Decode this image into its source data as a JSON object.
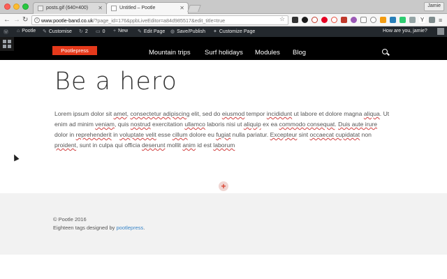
{
  "browser": {
    "tabs": [
      {
        "label": "posts.gif (640×400)"
      },
      {
        "label": "Untitled – Pootle"
      }
    ],
    "profile": "Jamie",
    "url_domain": "www.pootle-band.co.uk",
    "url_path": "/?page_id=176&ppbLiveEditor=a84d985517&edit_title=true"
  },
  "adminbar": {
    "site": "Pootle",
    "customise": "Customise",
    "updates": "2",
    "comments": "0",
    "new": "New",
    "edit_page": "Edit Page",
    "save_publish": "Save/Publish",
    "customize_page": "Customize Page",
    "greeting": "How are you, jamie?"
  },
  "site": {
    "logo": "Pootlepress",
    "nav": [
      "Mountain trips",
      "Surf holidays",
      "Modules",
      "Blog"
    ]
  },
  "content": {
    "title": "Be a hero",
    "lorem_1": "Lorem ipsum dolor sit ",
    "lorem_2": "amet",
    "lorem_3": ", ",
    "lorem_4": "consectetur adipiscing",
    "lorem_5": " elit, sed do ",
    "lorem_6": "eiusmod",
    "lorem_7": " tempor ",
    "lorem_8": "incididunt",
    "lorem_9": " ut labore et dolore magna ",
    "lorem_10": "aliqua",
    "lorem_11": ". Ut enim ad minim ",
    "lorem_12": "veniam",
    "lorem_13": ", quis ",
    "lorem_14": "nostrud",
    "lorem_15": " exercitation ",
    "lorem_16": "ullamco",
    "lorem_17": " laboris nisi ut ",
    "lorem_18": "aliquip",
    "lorem_19": " ex ea ",
    "lorem_20": "commodo consequat",
    "lorem_21": ". ",
    "lorem_22": "Duis aute irure",
    "lorem_23": " dolor in ",
    "lorem_24": "reprehenderit",
    "lorem_25": " in ",
    "lorem_26": "voluptate velit",
    "lorem_27": " esse ",
    "lorem_28": "cillum",
    "lorem_29": " dolore eu ",
    "lorem_30": "fugiat",
    "lorem_31": " nulla pariatur. ",
    "lorem_32": "Excepteur",
    "lorem_33": " sint ",
    "lorem_34": "occaecat cupidatat",
    "lorem_35": " non ",
    "lorem_36": "proident",
    "lorem_37": ", sunt in culpa qui officia ",
    "lorem_38": "deserunt",
    "lorem_39": " mollit ",
    "lorem_40": "anim",
    "lorem_41": " id est ",
    "lorem_42": "laborum",
    "add_row": "+"
  },
  "footer": {
    "copyright": "© Pootle 2016",
    "credit_prefix": "Eighteen tags designed by ",
    "credit_link": "pootlepress",
    "credit_suffix": "."
  },
  "colors": {
    "accent": "#e5391b",
    "adminbar": "#23282d",
    "header": "#000000",
    "link": "#3a86c8"
  }
}
